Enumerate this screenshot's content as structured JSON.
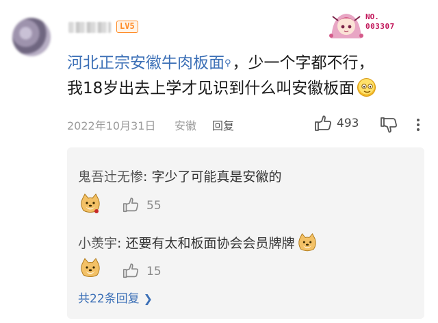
{
  "comment": {
    "level_badge": "LV5",
    "collect_badge": {
      "label": "NO.",
      "number": "003307"
    },
    "content": {
      "topic": "河北正宗安徽牛肉板面",
      "line1_rest": "，少一个字都不行，",
      "line2": "我18岁出去上学才见识到什么叫安徽板面"
    },
    "meta": {
      "date": "2022年10月31日",
      "location": "安徽",
      "reply_label": "回复",
      "like_count": "493"
    }
  },
  "replies": [
    {
      "user": "鬼吾辻无惨",
      "text": "字少了可能真是安徽的",
      "like_count": "55"
    },
    {
      "user": "小羡宇",
      "text": "还要有太和板面协会会员牌牌",
      "like_count": "15"
    }
  ],
  "more_replies": {
    "label": "共22条回复"
  },
  "colors": {
    "link": "#3b6fb6",
    "level": "#ff8a24",
    "collect": "#c2185b",
    "reply_bg": "#f4f4f4"
  },
  "icons": [
    "search-icon",
    "smile-emoji-icon",
    "thumb-up-icon",
    "thumb-down-icon",
    "more-vertical-icon",
    "doge-sticker-icon",
    "chevron-right-icon"
  ]
}
